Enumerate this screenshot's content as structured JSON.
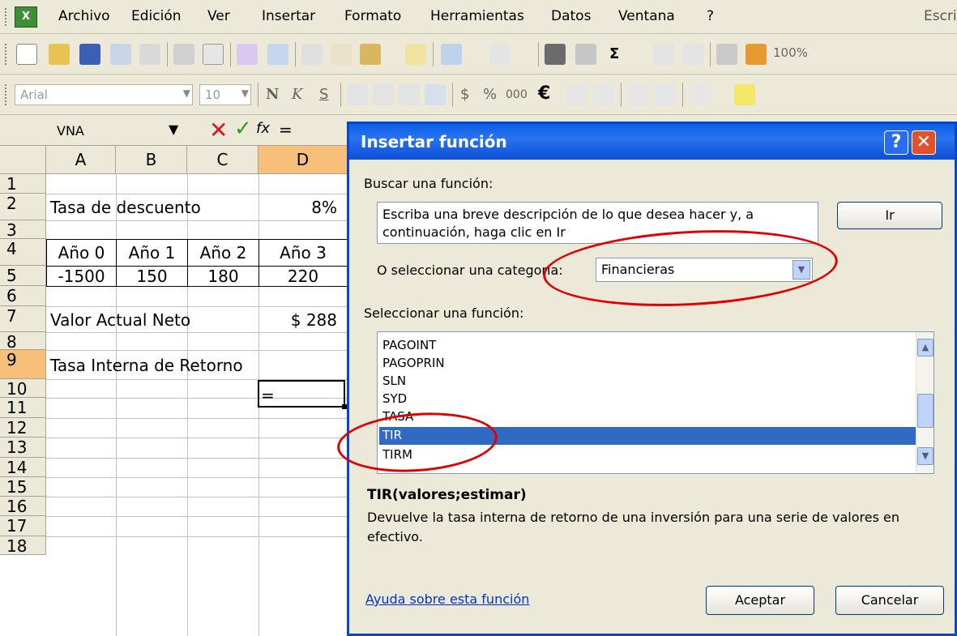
{
  "menubar": {
    "items": [
      "Archivo",
      "Edición",
      "Ver",
      "Insertar",
      "Formato",
      "Herramientas",
      "Datos",
      "Ventana",
      "?"
    ],
    "search_hint": "Escri"
  },
  "toolbar": {
    "font_name": "Arial",
    "font_size": "10",
    "zoom": "100%",
    "bold": "N",
    "italic": "K",
    "underline": "S",
    "currency": "$",
    "percent": "%",
    "thousands": "000",
    "euro": "€"
  },
  "formula_bar": {
    "name_box": "VNA",
    "cancel_icon": "✕",
    "enter_icon": "✓",
    "fx": "fx",
    "content": "="
  },
  "sheet": {
    "columns": [
      "A",
      "B",
      "C",
      "D"
    ],
    "rows": [
      "1",
      "2",
      "3",
      "4",
      "5",
      "6",
      "7",
      "8",
      "9",
      "10",
      "11",
      "12",
      "13",
      "14",
      "15",
      "16",
      "17",
      "18"
    ],
    "cells": {
      "a2": "Tasa de descuento",
      "d2": "8%",
      "a4": "Año 0",
      "b4": "Año 1",
      "c4": "Año 2",
      "d4": "Año 3",
      "a5": "-1500",
      "b5": "150",
      "c5": "180",
      "d5": "220",
      "a7": "Valor Actual Neto",
      "d7": "$ 288",
      "a9": "Tasa Interna de Retorno",
      "d9": "="
    }
  },
  "dialog": {
    "title": "Insertar función",
    "help_btn": "?",
    "close_btn": "✕",
    "search_label": "Buscar una función:",
    "search_text": "Escriba una breve descripción de lo que desea hacer y, a continuación, haga clic en Ir",
    "go_button": "Ir",
    "category_label": "O seleccionar una categoría:",
    "category_value": "Financieras",
    "select_label": "Seleccionar una función:",
    "functions": [
      "PAGOINT",
      "PAGOPRIN",
      "SLN",
      "SYD",
      "TASA",
      "TIR",
      "TIRM"
    ],
    "selected_function": "TIR",
    "signature": "TIR(valores;estimar)",
    "description": "Devuelve la tasa interna de retorno de una inversión para una serie de valores en efectivo.",
    "help_link": "Ayuda sobre esta función",
    "ok_button": "Aceptar",
    "cancel_button": "Cancelar"
  },
  "colors": {
    "title_bar": "#0a5fe8",
    "selection": "#316ac5",
    "annotation": "#e00000",
    "selected_header": "#f7c07a"
  }
}
